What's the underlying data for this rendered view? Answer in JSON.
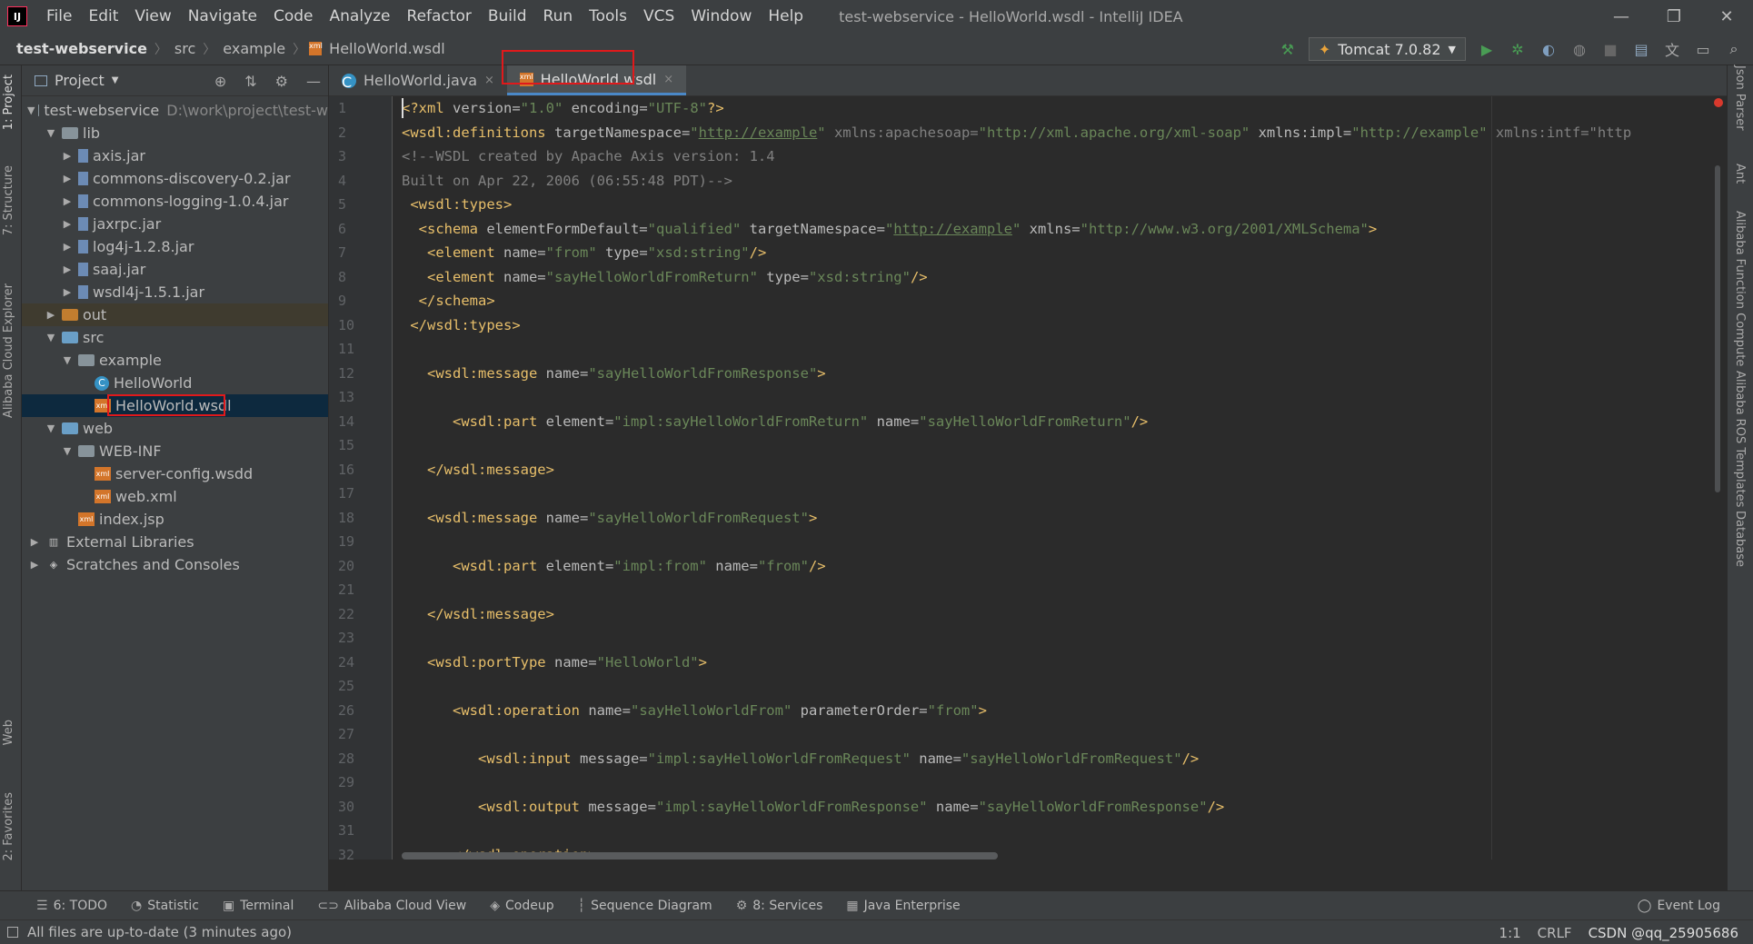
{
  "window": {
    "title": "test-webservice - HelloWorld.wsdl - IntelliJ IDEA",
    "logo": "IJ",
    "controls": {
      "minimize": "—",
      "restore": "❐",
      "close": "✕"
    }
  },
  "menu": [
    "File",
    "Edit",
    "View",
    "Navigate",
    "Code",
    "Analyze",
    "Refactor",
    "Build",
    "Run",
    "Tools",
    "VCS",
    "Window",
    "Help"
  ],
  "breadcrumb": [
    "test-webservice",
    "src",
    "example",
    "HelloWorld.wsdl"
  ],
  "run_config": {
    "label": "Tomcat 7.0.82"
  },
  "left_stripe": [
    "1: Project",
    "7: Structure",
    "Alibaba Cloud Explorer",
    "Web",
    "2: Favorites"
  ],
  "right_stripe": [
    "Json Parser",
    "Ant",
    "Alibaba Function Compute",
    "Alibaba ROS Templates",
    "Database"
  ],
  "project": {
    "header": "Project",
    "tree": [
      {
        "label": "test-webservice",
        "hint": "D:\\work\\project\\test-w",
        "depth": 0,
        "arrow": "▼",
        "icon": "folder"
      },
      {
        "label": "lib",
        "depth": 1,
        "arrow": "▼",
        "icon": "folder"
      },
      {
        "label": "axis.jar",
        "depth": 2,
        "arrow": "▶",
        "icon": "jar"
      },
      {
        "label": "commons-discovery-0.2.jar",
        "depth": 2,
        "arrow": "▶",
        "icon": "jar"
      },
      {
        "label": "commons-logging-1.0.4.jar",
        "depth": 2,
        "arrow": "▶",
        "icon": "jar"
      },
      {
        "label": "jaxrpc.jar",
        "depth": 2,
        "arrow": "▶",
        "icon": "jar"
      },
      {
        "label": "log4j-1.2.8.jar",
        "depth": 2,
        "arrow": "▶",
        "icon": "jar"
      },
      {
        "label": "saaj.jar",
        "depth": 2,
        "arrow": "▶",
        "icon": "jar"
      },
      {
        "label": "wsdl4j-1.5.1.jar",
        "depth": 2,
        "arrow": "▶",
        "icon": "jar"
      },
      {
        "label": "out",
        "depth": 1,
        "arrow": "▶",
        "icon": "folder-orange"
      },
      {
        "label": "src",
        "depth": 1,
        "arrow": "▼",
        "icon": "folder-blue"
      },
      {
        "label": "example",
        "depth": 2,
        "arrow": "▼",
        "icon": "folder"
      },
      {
        "label": "HelloWorld",
        "depth": 3,
        "arrow": "",
        "icon": "class"
      },
      {
        "label": "HelloWorld.wsdl",
        "depth": 3,
        "arrow": "",
        "icon": "xml"
      },
      {
        "label": "web",
        "depth": 1,
        "arrow": "▼",
        "icon": "folder-blue"
      },
      {
        "label": "WEB-INF",
        "depth": 2,
        "arrow": "▼",
        "icon": "folder"
      },
      {
        "label": "server-config.wsdd",
        "depth": 3,
        "arrow": "",
        "icon": "xml"
      },
      {
        "label": "web.xml",
        "depth": 3,
        "arrow": "",
        "icon": "xml"
      },
      {
        "label": "index.jsp",
        "depth": 2,
        "arrow": "",
        "icon": "xml"
      },
      {
        "label": "External Libraries",
        "depth": 0,
        "arrow": "▶",
        "icon": "lib"
      },
      {
        "label": "Scratches and Consoles",
        "depth": 0,
        "arrow": "▶",
        "icon": "scratch"
      }
    ]
  },
  "tabs": [
    {
      "label": "HelloWorld.java",
      "icon": "C",
      "active": false
    },
    {
      "label": "HelloWorld.wsdl",
      "icon": "xml",
      "active": true
    }
  ],
  "editor": {
    "lines": [
      [
        [
          "t",
          "<?xml "
        ],
        [
          "a",
          "version="
        ],
        [
          "v",
          "\"1.0\""
        ],
        [
          "a",
          " encoding="
        ],
        [
          "v",
          "\"UTF-8\""
        ],
        [
          "t",
          "?>"
        ]
      ],
      [
        [
          "t",
          "<wsdl:definitions "
        ],
        [
          "a",
          "targetNamespace="
        ],
        [
          "v",
          "\""
        ],
        [
          "u",
          "http://example"
        ],
        [
          "v",
          "\""
        ],
        [
          "c",
          " xmlns:apachesoap="
        ],
        [
          "v",
          "\"http://xml.apache.org/xml-soap\""
        ],
        [
          "a",
          " xmlns:impl="
        ],
        [
          "v",
          "\"http://example\""
        ],
        [
          "c",
          " xmlns:intf=\"http"
        ]
      ],
      [
        [
          "c",
          "<!--WSDL created by Apache Axis version: 1.4"
        ]
      ],
      [
        [
          "c",
          "Built on Apr 22, 2006 (06:55:48 PDT)-->"
        ]
      ],
      [
        [
          "t",
          " <wsdl:types>"
        ]
      ],
      [
        [
          "t",
          "  <schema "
        ],
        [
          "a",
          "elementFormDefault="
        ],
        [
          "v",
          "\"qualified\""
        ],
        [
          "a",
          " targetNamespace="
        ],
        [
          "v",
          "\""
        ],
        [
          "u",
          "http://example"
        ],
        [
          "v",
          "\""
        ],
        [
          "a",
          " xmlns="
        ],
        [
          "v",
          "\"http://www.w3.org/2001/XMLSchema\""
        ],
        [
          "t",
          ">"
        ]
      ],
      [
        [
          "t",
          "   <element "
        ],
        [
          "a",
          "name="
        ],
        [
          "v",
          "\"from\""
        ],
        [
          "a",
          " type="
        ],
        [
          "v",
          "\"xsd:string\""
        ],
        [
          "t",
          "/>"
        ]
      ],
      [
        [
          "t",
          "   <element "
        ],
        [
          "a",
          "name="
        ],
        [
          "v",
          "\"sayHelloWorldFromReturn\""
        ],
        [
          "a",
          " type="
        ],
        [
          "v",
          "\"xsd:string\""
        ],
        [
          "t",
          "/>"
        ]
      ],
      [
        [
          "t",
          "  </schema>"
        ]
      ],
      [
        [
          "t",
          " </wsdl:types>"
        ]
      ],
      [],
      [
        [
          "t",
          "   <wsdl:message "
        ],
        [
          "a",
          "name="
        ],
        [
          "v",
          "\"sayHelloWorldFromResponse\""
        ],
        [
          "t",
          ">"
        ]
      ],
      [],
      [
        [
          "t",
          "      <wsdl:part "
        ],
        [
          "a",
          "element="
        ],
        [
          "v",
          "\"impl:sayHelloWorldFromReturn\""
        ],
        [
          "a",
          " name="
        ],
        [
          "v",
          "\"sayHelloWorldFromReturn\""
        ],
        [
          "t",
          "/>"
        ]
      ],
      [],
      [
        [
          "t",
          "   </wsdl:message>"
        ]
      ],
      [],
      [
        [
          "t",
          "   <wsdl:message "
        ],
        [
          "a",
          "name="
        ],
        [
          "v",
          "\"sayHelloWorldFromRequest\""
        ],
        [
          "t",
          ">"
        ]
      ],
      [],
      [
        [
          "t",
          "      <wsdl:part "
        ],
        [
          "a",
          "element="
        ],
        [
          "v",
          "\"impl:from\""
        ],
        [
          "a",
          " name="
        ],
        [
          "v",
          "\"from\""
        ],
        [
          "t",
          "/>"
        ]
      ],
      [],
      [
        [
          "t",
          "   </wsdl:message>"
        ]
      ],
      [],
      [
        [
          "t",
          "   <wsdl:portType "
        ],
        [
          "a",
          "name="
        ],
        [
          "v",
          "\"HelloWorld\""
        ],
        [
          "t",
          ">"
        ]
      ],
      [],
      [
        [
          "t",
          "      <wsdl:operation "
        ],
        [
          "a",
          "name="
        ],
        [
          "v",
          "\"sayHelloWorldFrom\""
        ],
        [
          "a",
          " parameterOrder="
        ],
        [
          "v",
          "\"from\""
        ],
        [
          "t",
          ">"
        ]
      ],
      [],
      [
        [
          "t",
          "         <wsdl:input "
        ],
        [
          "a",
          "message="
        ],
        [
          "v",
          "\"impl:sayHelloWorldFromRequest\""
        ],
        [
          "a",
          " name="
        ],
        [
          "v",
          "\"sayHelloWorldFromRequest\""
        ],
        [
          "t",
          "/>"
        ]
      ],
      [],
      [
        [
          "t",
          "         <wsdl:output "
        ],
        [
          "a",
          "message="
        ],
        [
          "v",
          "\"impl:sayHelloWorldFromResponse\""
        ],
        [
          "a",
          " name="
        ],
        [
          "v",
          "\"sayHelloWorldFromResponse\""
        ],
        [
          "t",
          "/>"
        ]
      ],
      [],
      [
        [
          "t",
          "      </wsdl:operation>"
        ]
      ]
    ]
  },
  "toolwindows": [
    {
      "label": "6: TODO",
      "icon": "☰"
    },
    {
      "label": "Statistic",
      "icon": "◔"
    },
    {
      "label": "Terminal",
      "icon": "▣"
    },
    {
      "label": "Alibaba Cloud View",
      "icon": "⊂⊃"
    },
    {
      "label": "Codeup",
      "icon": "◈"
    },
    {
      "label": "Sequence Diagram",
      "icon": "┆"
    },
    {
      "label": "8: Services",
      "icon": "⚙"
    },
    {
      "label": "Java Enterprise",
      "icon": "▦"
    }
  ],
  "event_log": "Event Log",
  "status": {
    "message": "All files are up-to-date (3 minutes ago)",
    "position": "1:1",
    "line_sep": "CRLF",
    "watermark": "CSDN @qq_25905686"
  },
  "colors": {
    "accent": "#4a88c7",
    "highlight_box": "#e0191b",
    "run_green": "#499c54"
  }
}
